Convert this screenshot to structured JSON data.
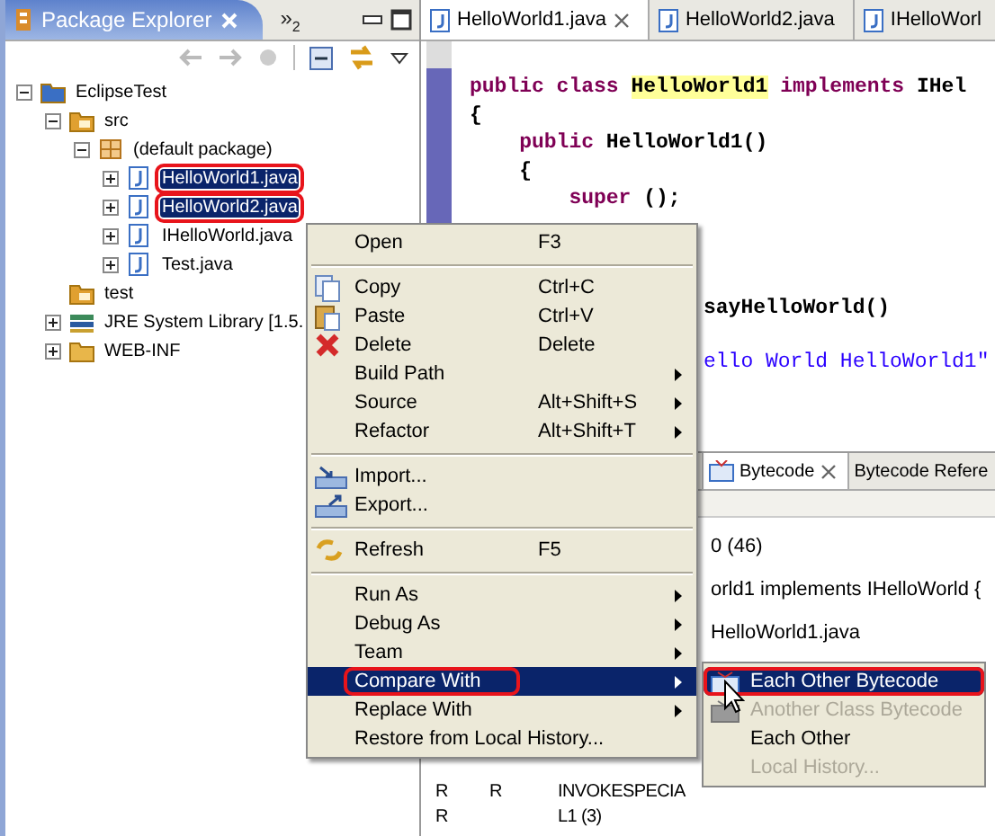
{
  "package_explorer": {
    "title": "Package Explorer",
    "overflow": "»",
    "overflow_count": "2",
    "tree": [
      {
        "label": "EclipseTest",
        "kind": "project",
        "expanded": true,
        "selected": false,
        "highlighted": false,
        "children": [
          {
            "label": "src",
            "kind": "source-folder",
            "expanded": true,
            "selected": false,
            "highlighted": false,
            "children": [
              {
                "label": "(default package)",
                "kind": "package",
                "expanded": true,
                "selected": false,
                "highlighted": false,
                "children": [
                  {
                    "label": "HelloWorld1.java",
                    "kind": "java-file",
                    "expanded": false,
                    "selected": true,
                    "highlighted": true
                  },
                  {
                    "label": "HelloWorld2.java",
                    "kind": "java-file",
                    "expanded": false,
                    "selected": true,
                    "highlighted": true
                  },
                  {
                    "label": "IHelloWorld.java",
                    "kind": "java-file",
                    "expanded": false,
                    "selected": false,
                    "highlighted": false
                  },
                  {
                    "label": "Test.java",
                    "kind": "java-file",
                    "expanded": false,
                    "selected": false,
                    "highlighted": false
                  }
                ]
              }
            ]
          },
          {
            "label": "test",
            "kind": "source-folder",
            "selected": false,
            "highlighted": false
          },
          {
            "label": "JRE System Library [1.5.",
            "kind": "library",
            "expanded": false,
            "selected": false,
            "highlighted": false
          },
          {
            "label": "WEB-INF",
            "kind": "folder",
            "expanded": false,
            "selected": false,
            "highlighted": false
          }
        ]
      }
    ]
  },
  "editor": {
    "tabs": [
      {
        "label": "HelloWorld1.java",
        "selected": true
      },
      {
        "label": "HelloWorld2.java",
        "selected": false
      },
      {
        "label": "IHelloWorl",
        "selected": false
      }
    ],
    "code_lines": [
      {
        "segments": [
          {
            "kind": "keyword",
            "text": "public class"
          },
          {
            "kind": "highlight",
            "text": "HelloWorld1"
          },
          {
            "kind": "keyword",
            "text": "implements"
          },
          {
            "kind": "plain",
            "text": "IHel"
          }
        ]
      },
      {
        "segments": [
          {
            "kind": "plain",
            "text": "{"
          }
        ]
      },
      {
        "segments": [
          {
            "kind": "keyword",
            "text": "public"
          },
          {
            "kind": "plain",
            "text": "HelloWorld1()"
          }
        ]
      },
      {
        "segments": [
          {
            "kind": "plain",
            "text": "{"
          }
        ]
      },
      {
        "segments": [
          {
            "kind": "keyword",
            "text": "super"
          },
          {
            "kind": "plain",
            "text": "();"
          }
        ]
      }
    ],
    "partial_lines": [
      {
        "segments": [
          {
            "kind": "plain",
            "text": "sayHelloWorld()"
          }
        ]
      },
      {
        "segments": [
          {
            "kind": "string",
            "text": "ello World HelloWorld1\""
          }
        ]
      }
    ]
  },
  "bytecode_view": {
    "tabs": [
      {
        "label": "Bytecode",
        "selected": true
      },
      {
        "label": "Bytecode Refere",
        "selected": false
      }
    ],
    "partial_lines": [
      "0 (46)",
      "orld1 implements IHelloWorld  {",
      "HelloWorld1.java"
    ],
    "rows": [
      {
        "column_1": "R",
        "column_2": "R",
        "column_3": "INVOKESPECIA"
      },
      {
        "column_1": "R",
        "column_3": "L1 (3)"
      }
    ]
  },
  "context_menu": {
    "items": [
      {
        "kind": "item",
        "label": "Open",
        "shortcut": "F3",
        "submenu": false,
        "selected": false,
        "highlighted": false
      },
      {
        "kind": "separator"
      },
      {
        "kind": "item",
        "label": "Copy",
        "shortcut": "Ctrl+C",
        "submenu": false,
        "selected": false,
        "highlighted": false
      },
      {
        "kind": "item",
        "label": "Paste",
        "shortcut": "Ctrl+V",
        "submenu": false,
        "selected": false,
        "highlighted": false
      },
      {
        "kind": "item",
        "label": "Delete",
        "shortcut": "Delete",
        "submenu": false,
        "selected": false,
        "highlighted": false
      },
      {
        "kind": "item",
        "label": "Build Path",
        "submenu": true,
        "selected": false,
        "highlighted": false
      },
      {
        "kind": "item",
        "label": "Source",
        "shortcut": "Alt+Shift+S",
        "submenu": true,
        "selected": false,
        "highlighted": false
      },
      {
        "kind": "item",
        "label": "Refactor",
        "shortcut": "Alt+Shift+T",
        "submenu": true,
        "selected": false,
        "highlighted": false
      },
      {
        "kind": "separator"
      },
      {
        "kind": "item",
        "label": "Import...",
        "submenu": false,
        "selected": false,
        "highlighted": false
      },
      {
        "kind": "item",
        "label": "Export...",
        "submenu": false,
        "selected": false,
        "highlighted": false
      },
      {
        "kind": "separator"
      },
      {
        "kind": "item",
        "label": "Refresh",
        "shortcut": "F5",
        "submenu": false,
        "selected": false,
        "highlighted": false
      },
      {
        "kind": "separator"
      },
      {
        "kind": "item",
        "label": "Run As",
        "submenu": true,
        "selected": false,
        "highlighted": false
      },
      {
        "kind": "item",
        "label": "Debug As",
        "submenu": true,
        "selected": false,
        "highlighted": false
      },
      {
        "kind": "item",
        "label": "Team",
        "submenu": true,
        "selected": false,
        "highlighted": false
      },
      {
        "kind": "item",
        "label": "Compare With",
        "submenu": true,
        "selected": true,
        "highlighted": true
      },
      {
        "kind": "item",
        "label": "Replace With",
        "submenu": true,
        "selected": false,
        "highlighted": false
      },
      {
        "kind": "item",
        "label": "Restore from Local History...",
        "submenu": false,
        "selected": false,
        "highlighted": false
      }
    ]
  },
  "submenu": {
    "items": [
      {
        "label": "Each Other Bytecode",
        "selected": true,
        "disabled": false,
        "highlighted": true
      },
      {
        "label": "Another Class Bytecode",
        "selected": false,
        "disabled": true,
        "highlighted": false
      },
      {
        "label": "Each Other",
        "selected": false,
        "disabled": false,
        "highlighted": false
      },
      {
        "label": "Local History...",
        "selected": false,
        "disabled": true,
        "highlighted": false
      }
    ]
  }
}
